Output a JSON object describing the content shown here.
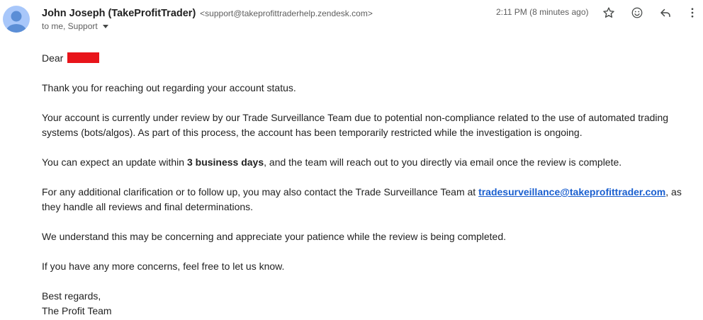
{
  "header": {
    "sender_name": "John Joseph (TakeProfitTrader)",
    "sender_email": "<support@takeprofittraderhelp.zendesk.com>",
    "recipients": "to me, Support",
    "timestamp": "2:11 PM (8 minutes ago)",
    "icons": [
      "star-icon",
      "emoji-icon",
      "reply-icon",
      "more-vert-icon"
    ]
  },
  "message": {
    "greeting": "Dear",
    "p1": "Thank you for reaching out regarding your account status.",
    "p2": "Your account is currently under review by our Trade Surveillance Team due to potential non-compliance related to the use of automated trading systems (bots/algos). As part of this process, the account has been temporarily restricted while the investigation is ongoing.",
    "p3_before": "You can expect an update within ",
    "p3_bold": "3 business days",
    "p3_after": ", and the team will reach out to you directly via email once the review is complete.",
    "p4_before": "For any additional clarification or to follow up, you may also contact the Trade Surveillance Team at ",
    "p4_link": "tradesurveillance@takeprofittrader.com",
    "p4_after": ", as they handle all reviews and final determinations.",
    "p5": "We understand this may be concerning and appreciate your patience while the review is being completed.",
    "p6": "If you have any more concerns, feel free to let us know.",
    "closing": "Best regards,",
    "signature": "The Profit Team"
  },
  "colors": {
    "avatar_bg": "#a8c7fa",
    "avatar_fg": "#5b8ed6",
    "link": "#1a5fcf",
    "redaction": "#e8141a"
  }
}
